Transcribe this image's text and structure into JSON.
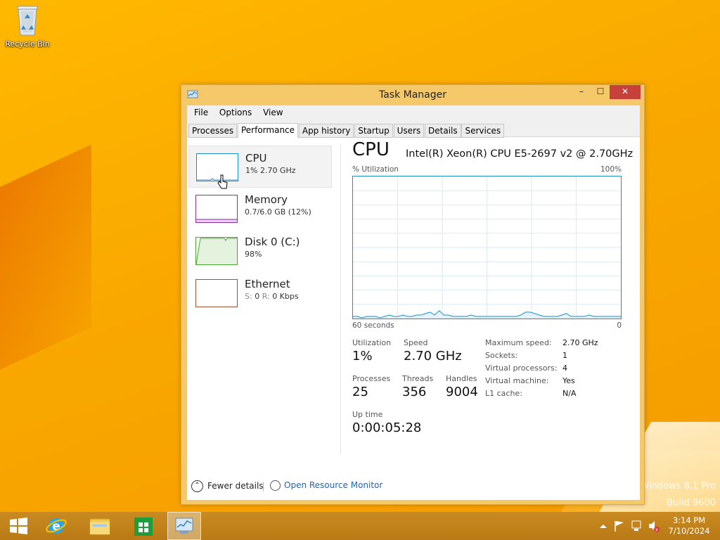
{
  "desktop": {
    "recycle_bin_label": "Recycle Bin",
    "watermark_line1": "Windows 8.1 Pro",
    "watermark_line2": "Build 9600"
  },
  "window": {
    "title": "Task Manager",
    "min_glyph": "–",
    "max_glyph": "☐",
    "close_glyph": "✕"
  },
  "menu": [
    "File",
    "Options",
    "View"
  ],
  "tabs": [
    "Processes",
    "Performance",
    "App history",
    "Startup",
    "Users",
    "Details",
    "Services"
  ],
  "active_tab": "Performance",
  "resources": [
    {
      "name": "CPU",
      "detail": "1%  2.70 GHz",
      "color": "#1a8fd0"
    },
    {
      "name": "Memory",
      "detail": "0.7/6.0 GB (12%)",
      "color": "#8b2fa8"
    },
    {
      "name": "Disk 0 (C:)",
      "detail": "98%",
      "color": "#4da633"
    },
    {
      "name": "Ethernet",
      "detail_s": "S:",
      "detail_s_val": "0",
      "detail_r": "R:",
      "detail_r_val": "0 Kbps",
      "color": "#a0522d"
    }
  ],
  "cpu_panel": {
    "title": "CPU",
    "model": "Intel(R) Xeon(R) CPU E5-2697 v2 @ 2.70GHz",
    "graph_label_left": "% Utilization",
    "graph_label_right": "100%",
    "graph_bottom_left": "60 seconds",
    "graph_bottom_right": "0",
    "utilization_label": "Utilization",
    "utilization_value": "1%",
    "speed_label": "Speed",
    "speed_value": "2.70 GHz",
    "processes_label": "Processes",
    "processes_value": "25",
    "threads_label": "Threads",
    "threads_value": "356",
    "handles_label": "Handles",
    "handles_value": "9004",
    "uptime_label": "Up time",
    "uptime_value": "0:00:05:28",
    "details": [
      {
        "label": "Maximum speed:",
        "value": "2.70 GHz"
      },
      {
        "label": "Sockets:",
        "value": "1"
      },
      {
        "label": "Virtual processors:",
        "value": "4"
      },
      {
        "label": "Virtual machine:",
        "value": "Yes"
      },
      {
        "label": "L1 cache:",
        "value": "N/A"
      }
    ]
  },
  "footer": {
    "fewer_details": "Fewer details",
    "resource_monitor": "Open Resource Monitor"
  },
  "taskbar": {
    "time": "3:14 PM",
    "date": "7/10/2024"
  },
  "chart_data": {
    "type": "line",
    "ylabel": "% Utilization",
    "ylim": [
      0,
      100
    ],
    "xlim": [
      60,
      0
    ],
    "series": [
      {
        "values": [
          1,
          1,
          0,
          1,
          1,
          1,
          0,
          1,
          2,
          1,
          1,
          2,
          1,
          1,
          2,
          2,
          3,
          4,
          2,
          5,
          2,
          2,
          1,
          1,
          1,
          1,
          2,
          1,
          1,
          1,
          1,
          1,
          1,
          1,
          1,
          1,
          1,
          2,
          4,
          4,
          3,
          2,
          1,
          1,
          1,
          1,
          2,
          3,
          1,
          1,
          1,
          1,
          2,
          1,
          1,
          1,
          1,
          1,
          1,
          1
        ]
      }
    ]
  }
}
